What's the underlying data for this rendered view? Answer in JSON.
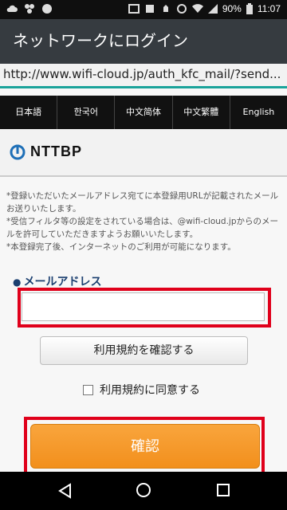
{
  "status_bar": {
    "battery": "90%",
    "time": "11:07",
    "icons": [
      "cloud-upload-icon",
      "android-icon",
      "chat-icon",
      "image-icon",
      "sim-icon",
      "silent-icon",
      "alarm-icon",
      "wifi-icon",
      "signal-icon",
      "battery-icon"
    ]
  },
  "app_bar": {
    "title": "ネットワークにログイン"
  },
  "url_bar": {
    "url": "http://www.wifi-cloud.jp/auth_kfc_mail/?send..."
  },
  "languages": [
    "日本語",
    "한국어",
    "中文简体",
    "中文繁體",
    "English"
  ],
  "brand": {
    "logo_text": "NTTBP"
  },
  "notice": [
    "*登録いただいたメールアドレス宛てに本登録用URLが記載されたメールお送りいたします。",
    "*受信フィルタ等の設定をされている場合は、@wifi-cloud.jpからのメールを許可していただきますようお願いいたします。",
    "*本登録完了後、インターネットのご利用が可能になります。"
  ],
  "form": {
    "email_label": "メールアドレス",
    "email_value": "",
    "terms_button": "利用規約を確認する",
    "agree_label": "利用規約に同意する",
    "confirm_button": "確認"
  },
  "colors": {
    "app_bar": "#363b40",
    "accent_line": "#1aa39a",
    "highlight": "#e0001b",
    "confirm": "#f39a2c",
    "label": "#1b3f70"
  }
}
